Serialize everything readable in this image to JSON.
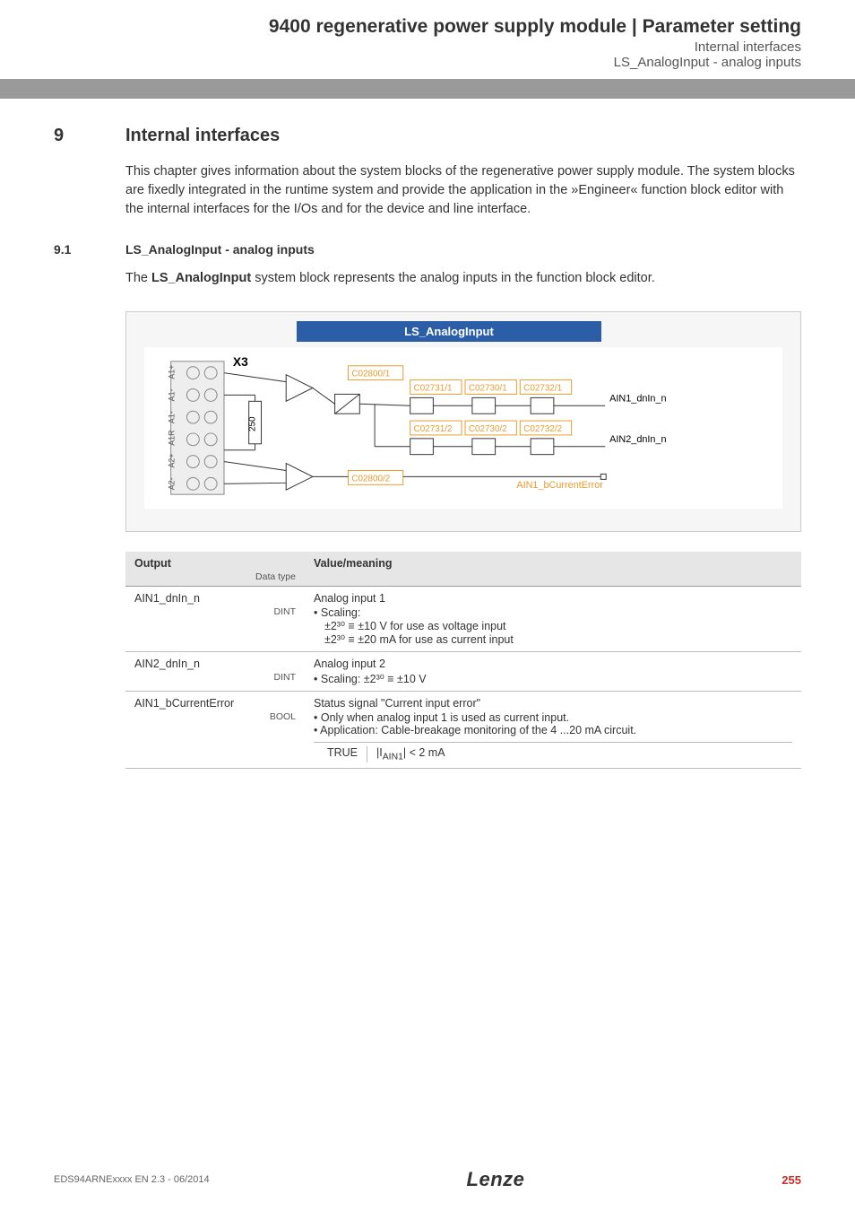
{
  "header": {
    "title": "9400 regenerative power supply module | Parameter setting",
    "sub1": "Internal interfaces",
    "sub2": "LS_AnalogInput - analog inputs"
  },
  "section": {
    "num": "9",
    "title": "Internal interfaces",
    "body": "This chapter gives information about the system blocks of the regenerative power supply module. The system blocks are fixedly integrated in the runtime system and provide the application in the »Engineer« function block editor with the internal interfaces for the I/Os and for the device and line interface."
  },
  "subsection": {
    "num": "9.1",
    "title": "LS_AnalogInput - analog inputs",
    "body_pre": "The ",
    "body_bold": "LS_AnalogInput",
    "body_post": " system block represents the analog inputs in the function block editor."
  },
  "diagram": {
    "title": "LS_AnalogInput",
    "x3": "X3",
    "resistor": "250",
    "terminals": [
      "A1+",
      "A1-",
      "A1-",
      "A1R",
      "A2+",
      "A2-"
    ],
    "codes_row1": [
      "C02800/1",
      "C02731/1",
      "C02730/1",
      "C02732/1"
    ],
    "codes_row2": [
      "C02731/2",
      "C02730/2",
      "C02732/2"
    ],
    "code_bottom": "C02800/2",
    "out1": "AIN1_dnIn_n",
    "out2": "AIN2_dnIn_n",
    "out3": "AIN1_bCurrentError"
  },
  "table": {
    "head_output": "Output",
    "head_dtype": "Data type",
    "head_value": "Value/meaning",
    "rows": [
      {
        "name": "AIN1_dnIn_n",
        "dtype": "DINT",
        "value_title": "Analog input 1",
        "bullets": [
          "Scaling:"
        ],
        "sub1": "±2³⁰ ≡ ±10 V for use as voltage input",
        "sub2": "±2³⁰ ≡ ±20 mA for use as current input"
      },
      {
        "name": "AIN2_dnIn_n",
        "dtype": "DINT",
        "value_title": "Analog input 2",
        "bullets": [
          "Scaling: ±2³⁰ ≡ ±10 V"
        ]
      },
      {
        "name": "AIN1_bCurrentError",
        "dtype": "BOOL",
        "value_title": "Status signal \"Current input error\"",
        "bullets": [
          "Only when analog input 1 is used as current input.",
          "Application: Cable-breakage monitoring of the 4 ...20 mA circuit."
        ],
        "inner_key": "TRUE",
        "inner_val": "|I_AIN1| < 2 mA"
      }
    ]
  },
  "footer": {
    "left": "EDS94ARNExxxx EN 2.3 - 06/2014",
    "logo": "Lenze",
    "page": "255"
  }
}
